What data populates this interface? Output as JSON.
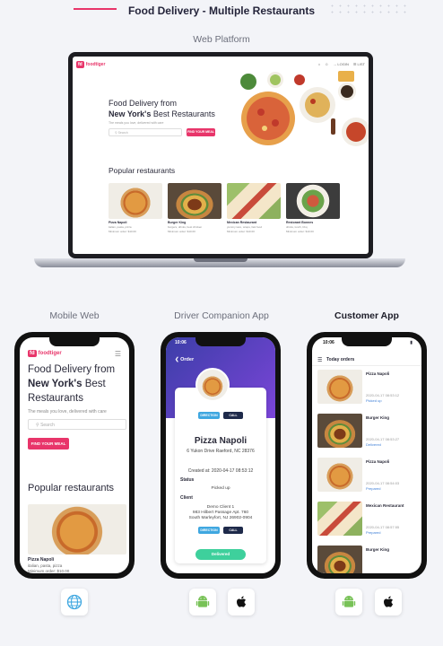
{
  "header": {
    "title": "Food Delivery - Multiple Restaurants"
  },
  "sections": {
    "web": "Web Platform",
    "mobile": "Mobile Web",
    "driver": "Driver Companion App",
    "customer": "Customer App"
  },
  "web": {
    "logo_box": "fd",
    "logo_text": "foodtiger",
    "nav": [
      "⌂",
      "☺",
      "→ LOGIN",
      "☰ LIST"
    ],
    "hero_line1": "Food Delivery from",
    "hero_strong": "New York's",
    "hero_line2": "Best Restaurants",
    "hero_sub": "The meals you love, delivered with care",
    "search_placeholder": "Search",
    "find_btn": "FIND YOUR MEAL",
    "popular": "Popular restaurants",
    "cards": [
      {
        "name": "Pizza Napoli",
        "cuisine": "italian, pasta, pizza",
        "min": "Minimum order: $10.00"
      },
      {
        "name": "Burger King",
        "cuisine": "burgers, drinks, best chicken",
        "min": "Minimum order: $10.00"
      },
      {
        "name": "Mexican Restaurant",
        "cuisine": "yummy taco, wraps, fast food",
        "min": "Minimum order: $10.00"
      },
      {
        "name": "Restorant Bonnes",
        "cuisine": "drinks, lunch, bbq",
        "min": "Minimum order: $10.00"
      }
    ]
  },
  "mobile": {
    "logo_box": "fd",
    "logo_text": "foodtiger",
    "hero_line1": "Food Delivery from",
    "hero_strong": "New York's",
    "hero_line2": "Best",
    "hero_line3": "Restaurants",
    "sub": "The meals you love, delivered with care",
    "search_placeholder": "Search",
    "find_btn": "FIND YOUR MEAL",
    "popular": "Popular restaurants",
    "item_name": "Pizza Napoli",
    "item_cuisine": "italian, pasta, pizza",
    "item_min": "Minimum order: $10.00"
  },
  "driver": {
    "time": "10:06",
    "title": "Order",
    "direction": "DIRECTION",
    "call": "CALL",
    "restaurant": "Pizza Napoli",
    "address": "6 Yukon Drive Raeford, NC 28376",
    "created": "Created at: 2020-04-17 08:53:12",
    "status_label": "Status",
    "status_value": "Picked up",
    "client_label": "Client",
    "client_name": "Demo Client 1",
    "client_addr1": "983 Hilbert Passage Apt. 760",
    "client_addr2": "South Marleyfort, NJ 26902-0904",
    "deliver_btn": "Delivered"
  },
  "customer": {
    "time": "10:06",
    "title": "Today orders",
    "orders": [
      {
        "name": "Pizza Napoli",
        "date": "2020-04-17 08:53:12",
        "status": "Picked up"
      },
      {
        "name": "Burger King",
        "date": "2020-04-17 08:53:27",
        "status": "Delivered"
      },
      {
        "name": "Pizza Napoli",
        "date": "2020-04-17 08:54:03",
        "status": "Prepared"
      },
      {
        "name": "Mexican Restaurant",
        "date": "2020-04-17 08:57:55",
        "status": "Prepared"
      },
      {
        "name": "Burger King",
        "date": "",
        "status": ""
      }
    ]
  },
  "icons": [
    "globe-icon",
    "android-icon",
    "apple-icon"
  ],
  "colors": {
    "accent": "#e8356a",
    "driver_purple": "#5b3fc4",
    "deliver_green": "#3ed09c"
  }
}
